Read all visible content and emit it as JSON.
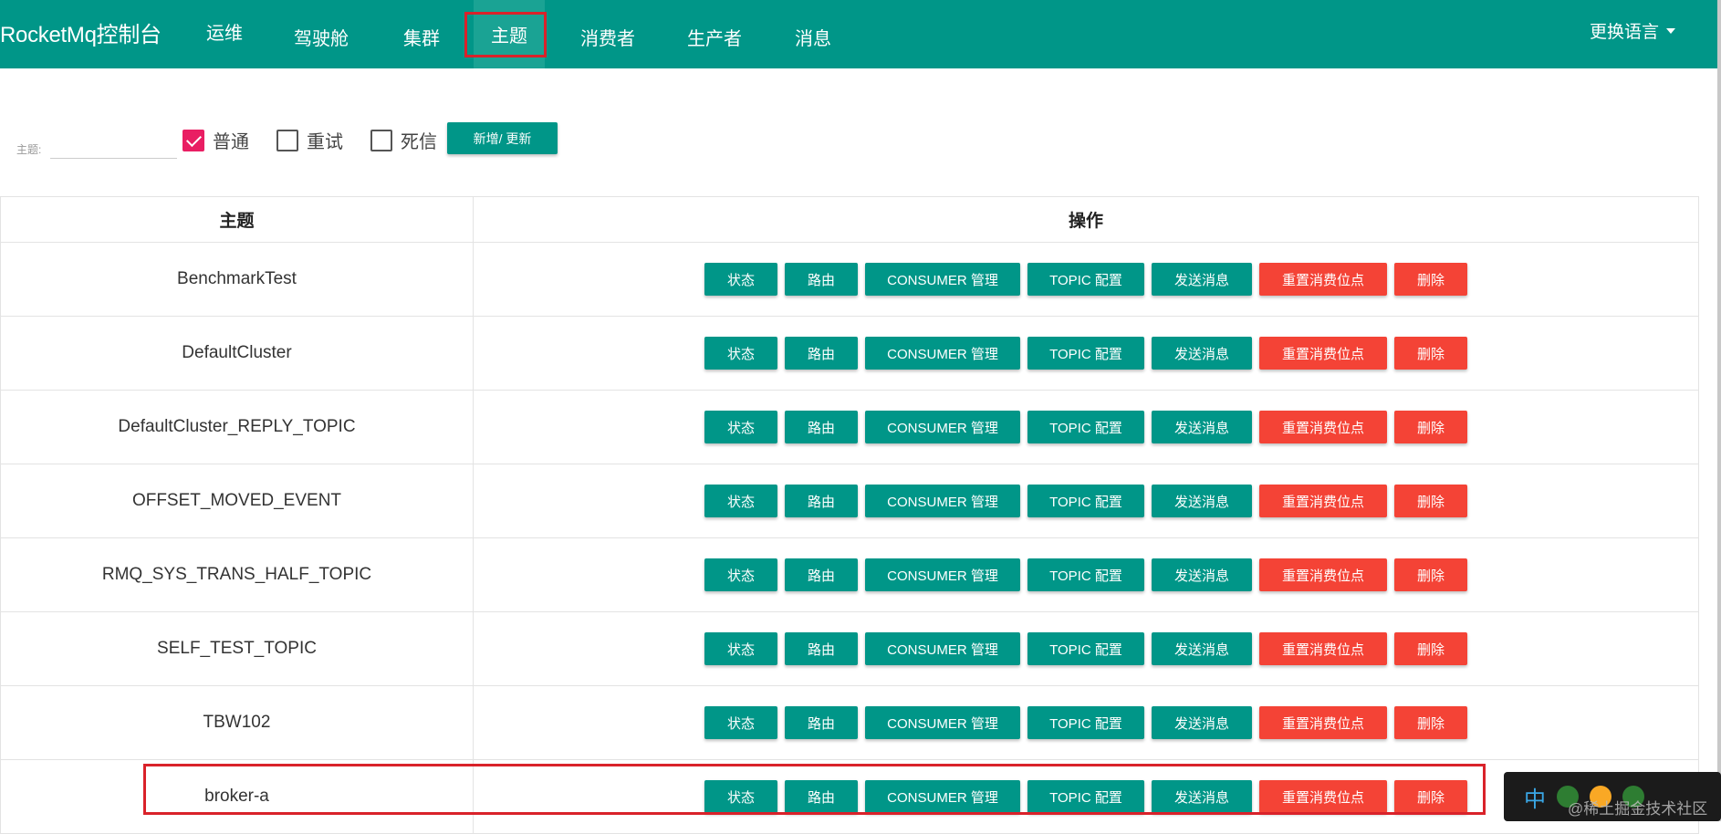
{
  "app": {
    "brand": "RocketMq控制台",
    "language_label": "更换语言"
  },
  "nav": [
    {
      "label": "运维"
    },
    {
      "label": "驾驶舱"
    },
    {
      "label": "集群"
    },
    {
      "label": "主题",
      "active": true
    },
    {
      "label": "消费者"
    },
    {
      "label": "生产者"
    },
    {
      "label": "消息"
    }
  ],
  "filter": {
    "topic_label": "主题:",
    "topic_value": "",
    "checkboxes": [
      {
        "label": "普通",
        "checked": true
      },
      {
        "label": "重试",
        "checked": false
      },
      {
        "label": "死信",
        "checked": false
      }
    ],
    "add_update_label": "新增/ 更新"
  },
  "table": {
    "headers": {
      "topic": "主题",
      "ops": "操作"
    },
    "action_labels": {
      "status": "状态",
      "route": "路由",
      "consumer": "CONSUMER 管理",
      "topic_config": "TOPIC 配置",
      "send": "发送消息",
      "reset": "重置消费位点",
      "delete": "删除"
    },
    "rows": [
      "BenchmarkTest",
      "DefaultCluster",
      "DefaultCluster_REPLY_TOPIC",
      "OFFSET_MOVED_EVENT",
      "RMQ_SYS_TRANS_HALF_TOPIC",
      "SELF_TEST_TOPIC",
      "TBW102",
      "broker-a"
    ]
  },
  "ime": {
    "mode": "中"
  },
  "watermark": "@稀土掘金技术社区",
  "colors": {
    "primary": "#009688",
    "danger": "#f44336",
    "checkbox": "#e91e63",
    "highlight": "#d9222a"
  }
}
